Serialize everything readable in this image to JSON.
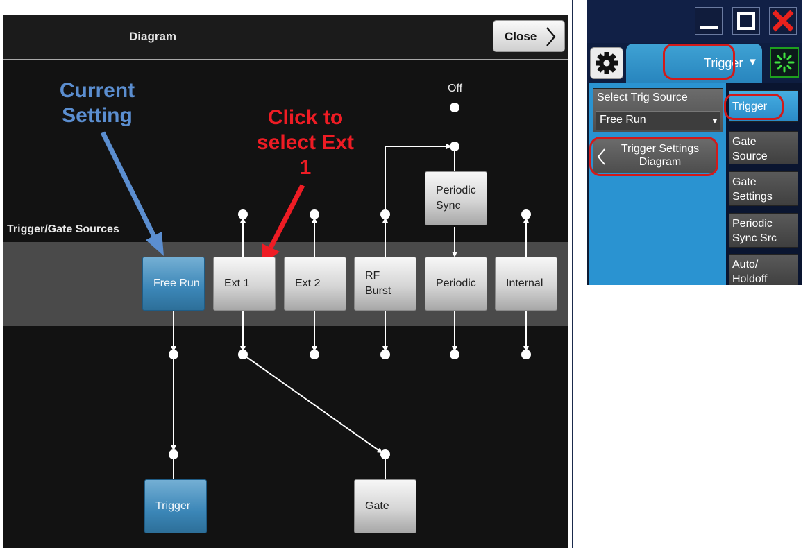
{
  "diagram": {
    "title": "Diagram",
    "close_label": "Close",
    "band_label": "Trigger/Gate Sources",
    "off_label": "Off",
    "sources": [
      "Free Run",
      "Ext 1",
      "Ext 2",
      "RF Burst",
      "Periodic",
      "Internal"
    ],
    "periodic_sync_label": "Periodic Sync",
    "trigger_label": "Trigger",
    "gate_label": "Gate",
    "annotation_current": "Current Setting",
    "annotation_click": "Click to select Ext 1"
  },
  "trigger_panel": {
    "tab_label": "Trigger",
    "select_label": "Select Trig Source",
    "select_value": "Free Run",
    "settings_button": "Trigger Settings Diagram",
    "right_buttons": [
      "Trigger",
      "Gate Source",
      "Gate Settings",
      "Periodic Sync Src",
      "Auto/ Holdoff"
    ]
  },
  "colors": {
    "selected_blue": "#3b86b7",
    "annotation_blue": "#5b8ed0",
    "annotation_red": "#ee1c24",
    "highlight_ring": "#d21a1a"
  },
  "icons": [
    "chevron-right-icon",
    "gear-icon",
    "minimize-icon",
    "maximize-icon",
    "close-x-icon",
    "spinner-icon",
    "dropdown-arrow-icon",
    "chevron-left-icon"
  ]
}
